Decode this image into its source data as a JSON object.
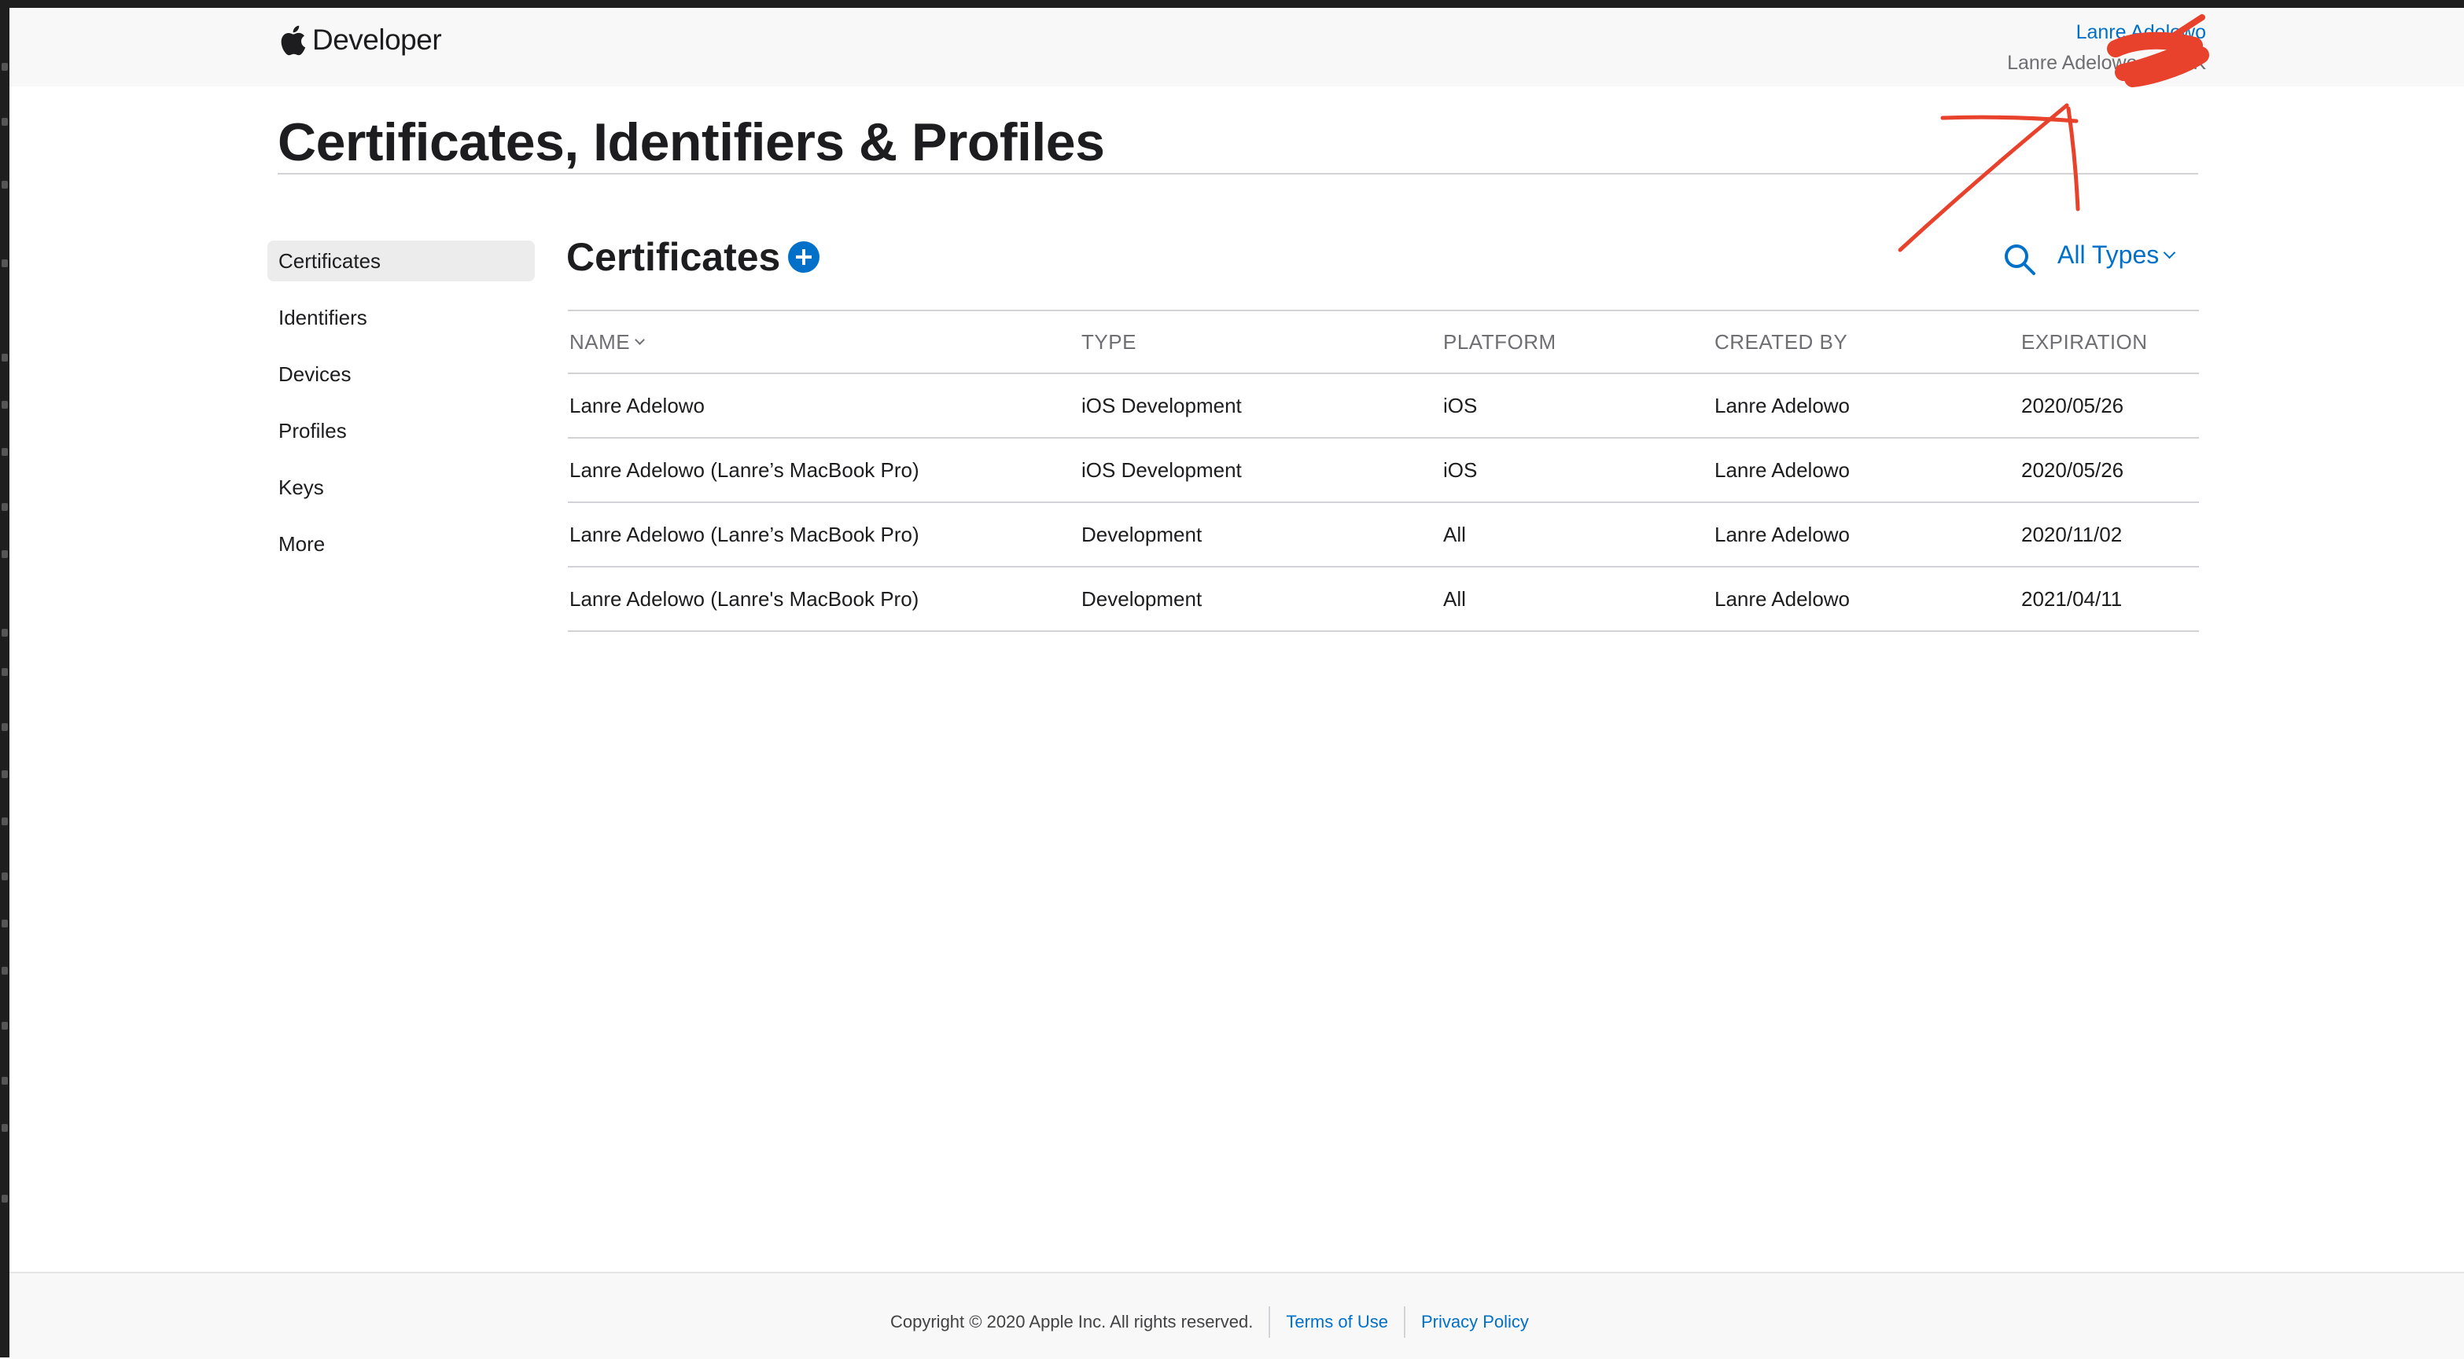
{
  "header": {
    "brand": "Developer",
    "account_name": "Lanre Adelowo",
    "account_team": "Lanre Adelowo - 2VDK"
  },
  "page": {
    "title": "Certificates, Identifiers & Profiles"
  },
  "sidebar": {
    "items": [
      {
        "label": "Certificates",
        "active": true
      },
      {
        "label": "Identifiers"
      },
      {
        "label": "Devices"
      },
      {
        "label": "Profiles"
      },
      {
        "label": "Keys"
      },
      {
        "label": "More"
      }
    ]
  },
  "section": {
    "title": "Certificates",
    "filter_label": "All Types"
  },
  "table": {
    "columns": [
      "NAME",
      "TYPE",
      "PLATFORM",
      "CREATED BY",
      "EXPIRATION"
    ],
    "rows": [
      [
        "Lanre Adelowo",
        "iOS Development",
        "iOS",
        "Lanre Adelowo",
        "2020/05/26"
      ],
      [
        "Lanre Adelowo (Lanre’s MacBook Pro)",
        "iOS Development",
        "iOS",
        "Lanre Adelowo",
        "2020/05/26"
      ],
      [
        "Lanre Adelowo (Lanre’s MacBook Pro)",
        "Development",
        "All",
        "Lanre Adelowo",
        "2020/11/02"
      ],
      [
        "Lanre Adelowo (Lanre's MacBook Pro)",
        "Development",
        "All",
        "Lanre Adelowo",
        "2021/04/11"
      ]
    ]
  },
  "footer": {
    "copyright": "Copyright © 2020 Apple Inc. All rights reserved.",
    "terms": "Terms of Use",
    "privacy": "Privacy Policy"
  },
  "colors": {
    "accent": "#0070c9",
    "annotation": "#e8412c"
  }
}
